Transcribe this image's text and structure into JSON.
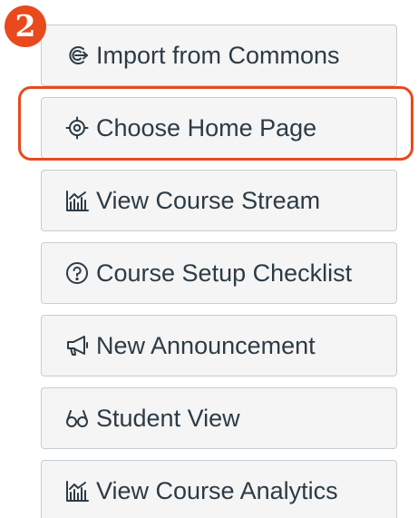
{
  "step_badge": "2",
  "accent_color": "#e8491d",
  "buttons": [
    {
      "label": "Import from Commons",
      "icon": "commons-import-icon"
    },
    {
      "label": "Choose Home Page",
      "icon": "target-icon"
    },
    {
      "label": "View Course Stream",
      "icon": "stream-chart-icon"
    },
    {
      "label": "Course Setup Checklist",
      "icon": "question-circle-icon"
    },
    {
      "label": "New Announcement",
      "icon": "megaphone-icon"
    },
    {
      "label": "Student View",
      "icon": "glasses-icon"
    },
    {
      "label": "View Course Analytics",
      "icon": "analytics-chart-icon"
    }
  ],
  "highlighted_button": "Choose Home Page"
}
